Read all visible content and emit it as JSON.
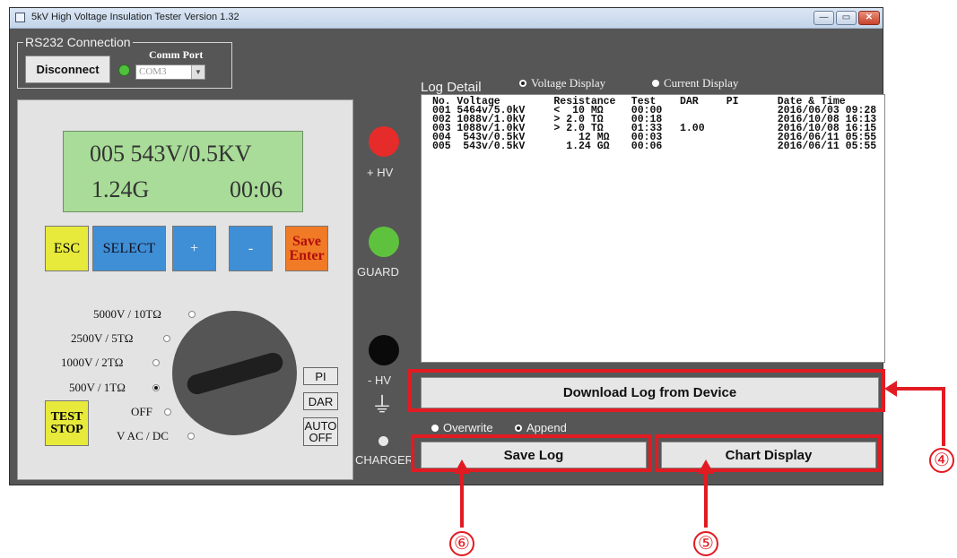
{
  "window": {
    "title": "5kV High Voltage Insulation Tester  Version 1.32",
    "controls": {
      "minimize": "—",
      "maximize": "▭",
      "close": "✕"
    }
  },
  "connection": {
    "legend": "RS232 Connection",
    "disconnect_label": "Disconnect",
    "comm_port_label": "Comm Port",
    "comm_port_value": "COM3",
    "dropdown_arrow": "▼"
  },
  "lcd": {
    "line1": "005    543V/0.5KV",
    "value": "1.24G",
    "time": "00:06"
  },
  "keys": {
    "esc": "ESC",
    "select": "SELECT",
    "plus": "+",
    "minus": "-",
    "save_enter_1": "Save",
    "save_enter_2": "Enter"
  },
  "ranges": {
    "r5000": "5000V / 10TΩ",
    "r2500": "2500V / 5TΩ",
    "r1000": "1000V / 2TΩ",
    "r500": "500V / 1TΩ",
    "off": "OFF",
    "vacdc": "V AC / DC",
    "selected": "500V / 1TΩ"
  },
  "side_buttons": {
    "pi": "PI",
    "dar": "DAR",
    "auto_off_1": "AUTO",
    "auto_off_2": "OFF"
  },
  "test_stop": {
    "line1": "TEST",
    "line2": "STOP"
  },
  "terminals": {
    "hv_plus": "+ HV",
    "guard": "GUARD",
    "hv_minus": "- HV",
    "ground_symbol": "⏚",
    "charger": "CHARGER"
  },
  "colors": {
    "terminal_hv_plus": "#e62b2b",
    "terminal_guard": "#5fc23e",
    "terminal_hv_minus": "#0a0a0a",
    "lcd_bg": "#a8dc98",
    "annotation": "#e21b22"
  },
  "log": {
    "title": "Log Detail",
    "display_options": [
      "Voltage Display",
      "Current Display"
    ],
    "display_selected": "Voltage Display",
    "columns": [
      "No.",
      "Voltage",
      "Resistance",
      "Test",
      "DAR",
      "PI",
      "Date & Time"
    ],
    "rows": [
      [
        "001",
        "5464v/5.0kV",
        "<  10 MΩ",
        "00:00",
        "",
        "",
        "2016/06/03 09:28"
      ],
      [
        "002",
        "1088v/1.0kV",
        "> 2.0 TΩ",
        "00:18",
        "",
        "",
        "2016/10/08 16:13"
      ],
      [
        "003",
        "1088v/1.0kV",
        "> 2.0 TΩ",
        "01:33",
        "1.00",
        "",
        "2016/10/08 16:15"
      ],
      [
        "004",
        " 543v/0.5kV",
        "    12 MΩ",
        "00:03",
        "",
        "",
        "2016/06/11 05:55"
      ],
      [
        "005",
        " 543v/0.5kV",
        "  1.24 GΩ",
        "00:06",
        "",
        "",
        "2016/06/11 05:55"
      ]
    ]
  },
  "actions": {
    "download": "Download Log from Device",
    "save_mode_options": [
      "Overwrite",
      "Append"
    ],
    "save_mode_selected": "Append",
    "save_log": "Save Log",
    "chart_display": "Chart Display"
  },
  "annotations": {
    "n4": "④",
    "n5": "⑤",
    "n6": "⑥"
  }
}
